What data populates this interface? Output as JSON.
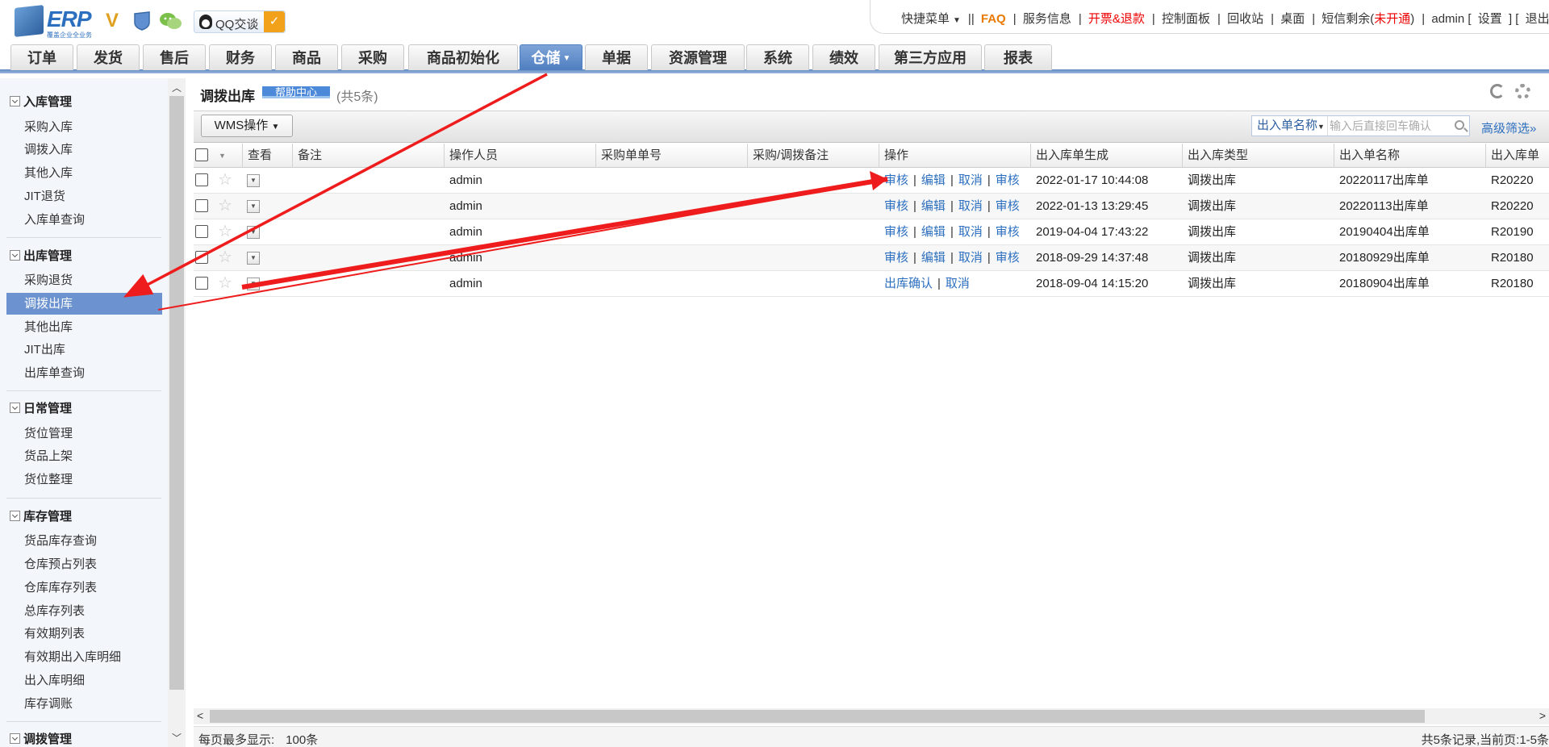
{
  "header": {
    "logo_text": "ERP",
    "logo_sub": "覆盖企业全业务",
    "qq_label": "QQ交谈",
    "links": [
      "快捷菜单",
      "FAQ",
      "服务信息",
      "开票&退款",
      "控制面板",
      "回收站",
      "桌面",
      "短信剩余(",
      "未开通",
      ")",
      "admin [",
      "设置",
      "] [",
      "退出",
      "]"
    ]
  },
  "nav": {
    "tabs": [
      "订单",
      "发货",
      "售后",
      "财务",
      "商品",
      "采购",
      "商品初始化",
      "仓储",
      "单据",
      "资源管理",
      "系统",
      "绩效",
      "第三方应用",
      "报表"
    ],
    "active": "仓储"
  },
  "sidebar": {
    "sections": [
      {
        "title": "入库管理",
        "items": [
          "采购入库",
          "调拨入库",
          "其他入库",
          "JIT退货",
          "入库单查询"
        ]
      },
      {
        "title": "出库管理",
        "items": [
          "采购退货",
          "调拨出库",
          "其他出库",
          "JIT出库",
          "出库单查询"
        ]
      },
      {
        "title": "日常管理",
        "items": [
          "货位管理",
          "货品上架",
          "货位整理"
        ]
      },
      {
        "title": "库存管理",
        "items": [
          "货品库存查询",
          "仓库预占列表",
          "仓库库存列表",
          "总库存列表",
          "有效期列表",
          "有效期出入库明细",
          "出入库明细",
          "库存调账"
        ]
      },
      {
        "title": "调拨管理",
        "items": []
      }
    ],
    "active_item": "调拨出库"
  },
  "page": {
    "title": "调拨出库",
    "help": "帮助中心",
    "count": "(共5条)"
  },
  "toolbar": {
    "wms_label": "WMS操作",
    "search_field": "出入单名称",
    "search_placeholder": "输入后直接回车确认",
    "adv_filter": "高级筛选»"
  },
  "table": {
    "columns": [
      "查看",
      "备注",
      "操作人员",
      "采购单单号",
      "采购/调拨备注",
      "操作",
      "出入库单生成",
      "出入库类型",
      "出入单名称",
      "出入库单"
    ],
    "rows": [
      {
        "operator": "admin",
        "ops": [
          "审核",
          "编辑",
          "取消",
          "审核"
        ],
        "created": "2022-01-17 10:44:08",
        "type": "调拨出库",
        "name": "20220117出库单",
        "code": "R20220"
      },
      {
        "operator": "admin",
        "ops": [
          "审核",
          "编辑",
          "取消",
          "审核"
        ],
        "created": "2022-01-13 13:29:45",
        "type": "调拨出库",
        "name": "20220113出库单",
        "code": "R20220"
      },
      {
        "operator": "admin",
        "ops": [
          "审核",
          "编辑",
          "取消",
          "审核"
        ],
        "created": "2019-04-04 17:43:22",
        "type": "调拨出库",
        "name": "20190404出库单",
        "code": "R20190"
      },
      {
        "operator": "admin",
        "ops": [
          "审核",
          "编辑",
          "取消",
          "审核"
        ],
        "created": "2018-09-29 14:37:48",
        "type": "调拨出库",
        "name": "20180929出库单",
        "code": "R20180"
      },
      {
        "operator": "admin",
        "ops": [
          "出库确认",
          "取消"
        ],
        "created": "2018-09-04 14:15:20",
        "type": "调拨出库",
        "name": "20180904出库单",
        "code": "R20180"
      }
    ]
  },
  "footer": {
    "per_page_label": "每页最多显示:",
    "per_page_value": "100条",
    "pager_info": "共5条记录,当前页:1-5条"
  },
  "colors": {
    "accent": "#4f7fc0",
    "link": "#2d6fbf",
    "arrow": "#ee1c1c",
    "faq": "#e87a00"
  }
}
